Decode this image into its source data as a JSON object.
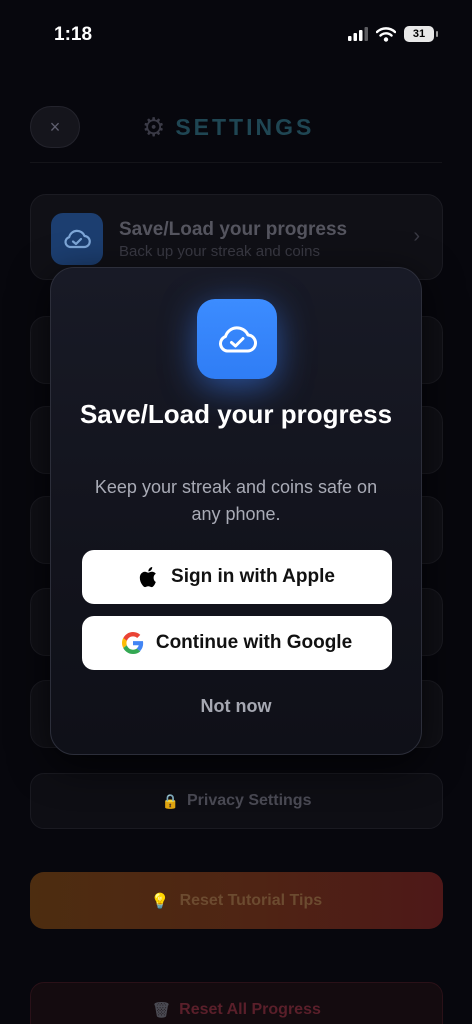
{
  "status_bar": {
    "time": "1:18",
    "battery": "31"
  },
  "header": {
    "close_label": "×",
    "title": "SETTINGS"
  },
  "progress_card": {
    "title": "Save/Load your progress",
    "subtitle": "Back up your streak and coins"
  },
  "privacy": {
    "label": "Privacy Settings"
  },
  "reset_tips": {
    "label": "Reset Tutorial Tips"
  },
  "reset_all": {
    "label": "Reset All Progress"
  },
  "modal": {
    "title": "Save/Load your progress",
    "subtitle": "Keep your streak and coins safe on any phone.",
    "apple_label": "Sign in with Apple",
    "google_label": "Continue with Google",
    "dismiss_label": "Not now"
  },
  "colors": {
    "accent_blue": "#3385ff",
    "modal_bg": "#151722",
    "button_bg": "#ffffff",
    "reset_tips_gradient": [
      "#4d2d10",
      "#4e1818"
    ],
    "danger_text": "#5a1f2a"
  },
  "icons": [
    "cloud-check-icon",
    "gear-icon",
    "close-icon",
    "chevron-right-icon",
    "lock-icon",
    "lightbulb-icon",
    "trash-icon",
    "apple-logo-icon",
    "google-logo-icon",
    "signal-icon",
    "wifi-icon",
    "battery-icon"
  ]
}
